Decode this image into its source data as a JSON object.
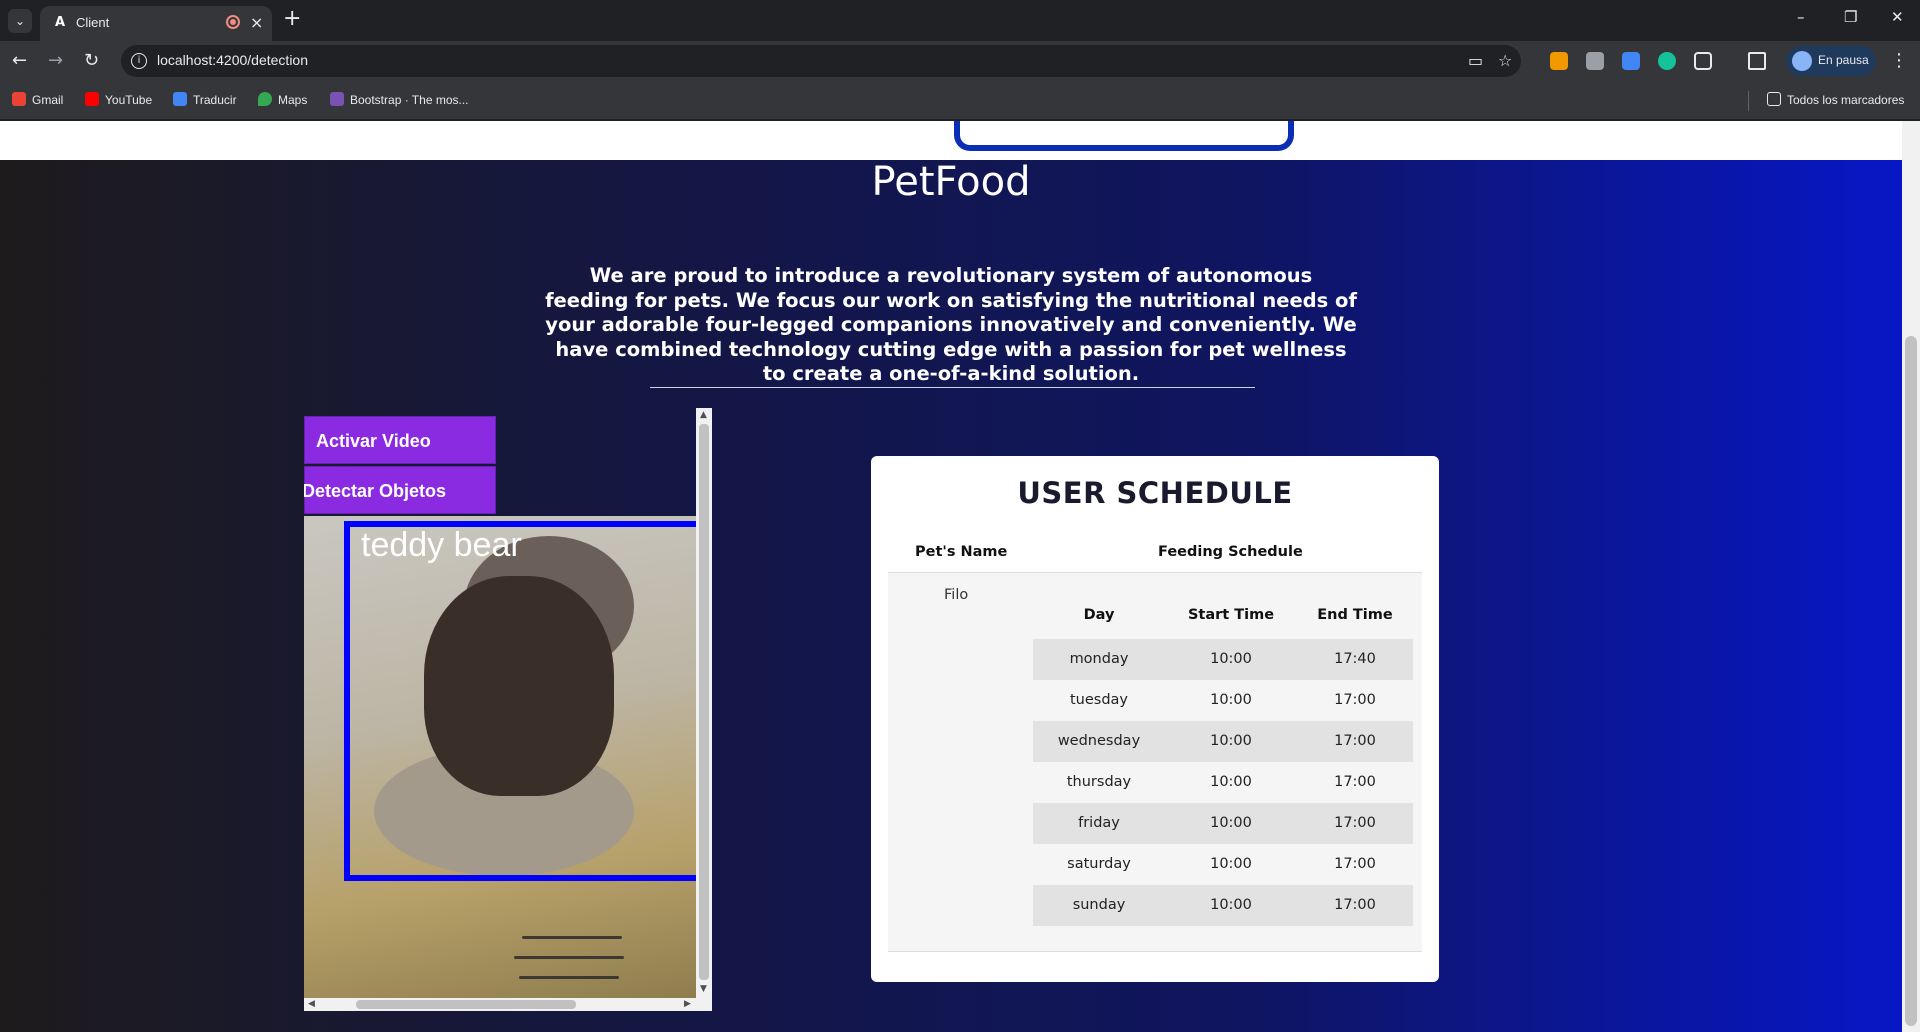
{
  "browser": {
    "tab_title": "Client",
    "tab_favicon": "A",
    "new_tab": "+",
    "url": "localhost:4200/detection",
    "profile_label": "En pausa",
    "bookmarks": [
      {
        "label": "Gmail",
        "color": "#ea4335"
      },
      {
        "label": "YouTube",
        "color": "#ff0000"
      },
      {
        "label": "Traducir",
        "color": "#4285f4"
      },
      {
        "label": "Maps",
        "color": "#34a853"
      },
      {
        "label": "Bootstrap · The mos...",
        "color": "#7952b3"
      }
    ],
    "all_bookmarks": "Todos los marcadores"
  },
  "page": {
    "brand": "PetFood",
    "intro": "We are proud to introduce a revolutionary system of autonomous feeding for pets. We focus our work on satisfying the nutritional needs of your adorable four-legged companions innovatively and conveniently. We have combined technology cutting edge with a passion for pet wellness to create a one-of-a-kind solution."
  },
  "detection": {
    "activate_video": "Activar Video",
    "detect_objects": "Detectar Objetos",
    "detected_label": "teddy bear",
    "box_color": "#0000ff",
    "button_color": "#8a2be2"
  },
  "schedule": {
    "title": "USER SCHEDULE",
    "col_pet_name": "Pet's Name",
    "col_feeding": "Feeding Schedule",
    "pet": "Filo",
    "sub_headers": [
      "Day",
      "Start Time",
      "End Time"
    ],
    "rows": [
      {
        "day": "monday",
        "start": "10:00",
        "end": "17:40"
      },
      {
        "day": "tuesday",
        "start": "10:00",
        "end": "17:00"
      },
      {
        "day": "wednesday",
        "start": "10:00",
        "end": "17:00"
      },
      {
        "day": "thursday",
        "start": "10:00",
        "end": "17:00"
      },
      {
        "day": "friday",
        "start": "10:00",
        "end": "17:00"
      },
      {
        "day": "saturday",
        "start": "10:00",
        "end": "17:00"
      },
      {
        "day": "sunday",
        "start": "10:00",
        "end": "17:00"
      }
    ]
  }
}
